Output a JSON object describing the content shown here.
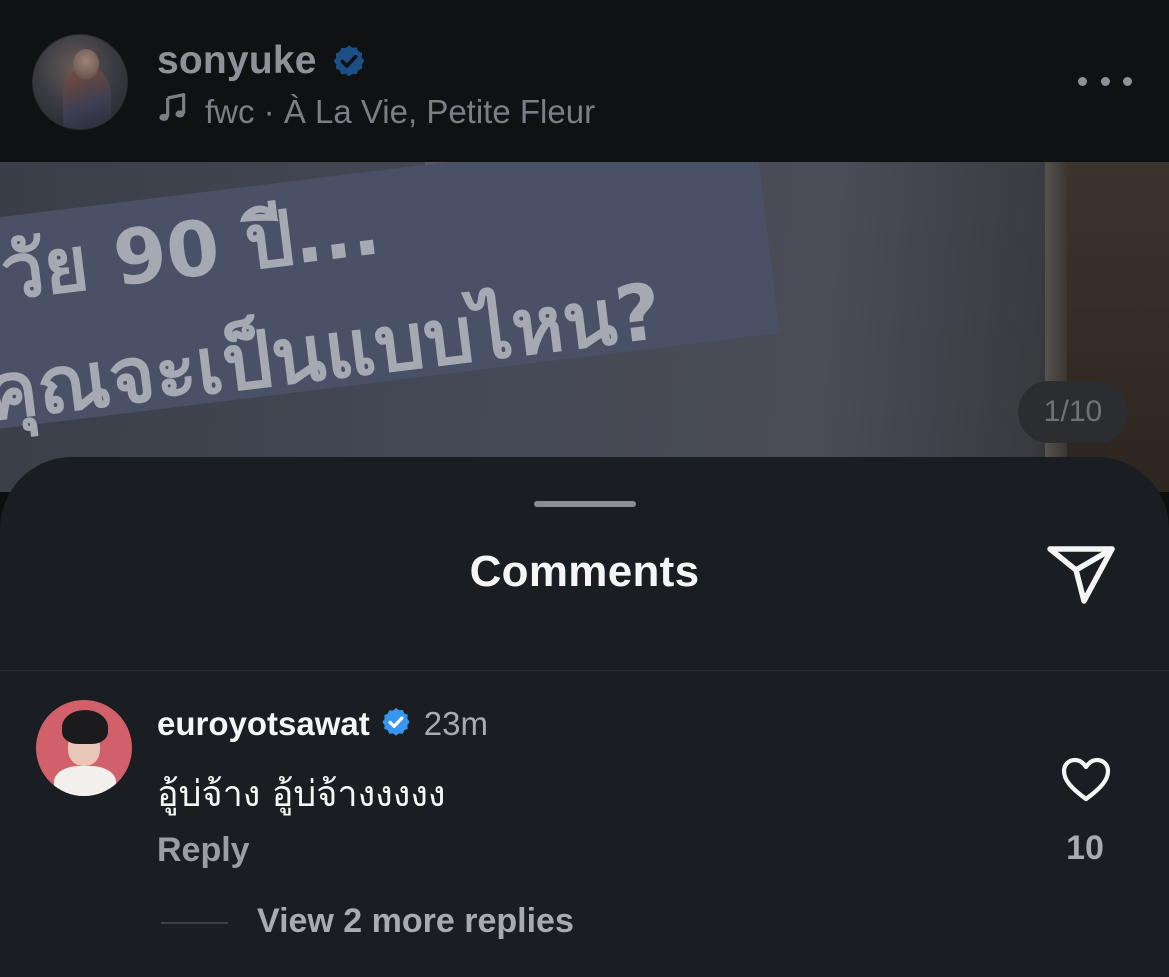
{
  "post": {
    "username": "sonyuke",
    "music": "fwc · À La Vie, Petite Fleur",
    "page_indicator": "1/10",
    "image_text_line1": "วัย 90 ปี...",
    "image_text_line2": "คุณจะเป็นแบบไหน?"
  },
  "sheet": {
    "title": "Comments"
  },
  "comment": {
    "username": "euroyotsawat",
    "time": "23m",
    "text": "อู้บ่จ้าง อู้บ่จ้างงงงง",
    "reply_label": "Reply",
    "like_count": "10",
    "view_replies": "View 2 more replies"
  },
  "colors": {
    "sheet_bg": "#1a1d21",
    "verified_blue": "#3797f0",
    "header_bg": "#0f1113"
  },
  "icons": [
    "music-note-icon",
    "verified-badge-icon",
    "more-options-icon",
    "share-icon",
    "heart-icon"
  ]
}
